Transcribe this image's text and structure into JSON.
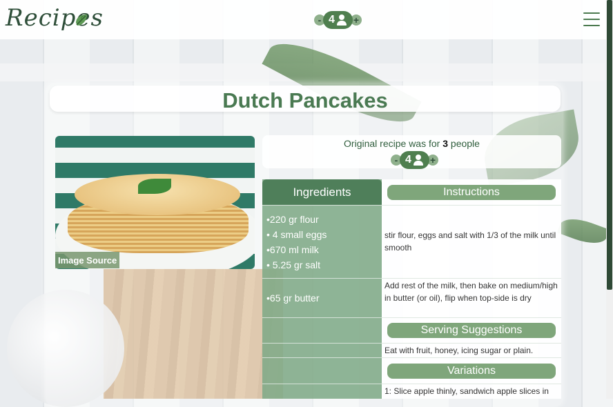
{
  "header": {
    "logo_text": "Recipes",
    "servings": "4",
    "minus": "-",
    "plus": "+"
  },
  "recipe": {
    "title": "Dutch Pancakes",
    "image_source_label": "Image Source",
    "original_prefix": "Original recipe was for",
    "original_count": "3",
    "original_suffix": "people",
    "servings": "4"
  },
  "table": {
    "ingredients_header": "Ingredients",
    "instructions_header": "Instructions",
    "ingredients_row1": [
      "•220 gr flour",
      "• 4 small eggs",
      "•670 ml milk",
      "• 5.25 gr salt"
    ],
    "instruction_row1": "stir flour, eggs and salt with 1/3 of the milk until smooth",
    "ingredients_row2": "•65 gr butter",
    "instruction_row2": "Add rest of the milk, then bake on medium/high in butter (or oil), flip when top-side is dry",
    "serving_header": "Serving Suggestions",
    "serving_text": "Eat with fruit, honey, icing sugar or plain.",
    "variations_header": "Variations",
    "variations_text": "1: Slice apple thinly, sandwich apple slices in"
  },
  "colors": {
    "accent": "#4a7a52",
    "ingredients_bg": "#80aa87",
    "header_pill": "#4f7f4f"
  },
  "icons": [
    "leaf-icon",
    "person-icon",
    "menu-icon"
  ]
}
